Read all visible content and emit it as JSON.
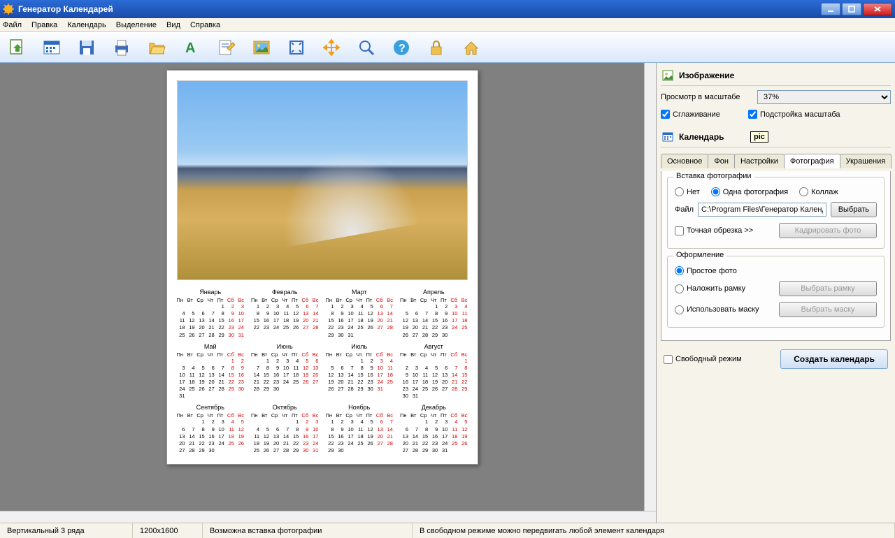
{
  "title": "Генератор Календарей",
  "menu": [
    "Файл",
    "Правка",
    "Календарь",
    "Выделение",
    "Вид",
    "Справка"
  ],
  "toolbar_icons": [
    "new-cal",
    "cal-grid",
    "save",
    "print",
    "folder",
    "font",
    "edit",
    "picture",
    "fit",
    "move",
    "zoom",
    "help",
    "lock",
    "home"
  ],
  "panel": {
    "image_header": "Изображение",
    "scale_label": "Просмотр в масштабе",
    "scale_value": "37%",
    "smooth": "Сглаживание",
    "fitscale": "Подстройка масштаба",
    "calendar_header": "Календарь",
    "tooltip": "pic",
    "tabs": [
      "Основное",
      "Фон",
      "Настройки",
      "Фотография",
      "Украшения"
    ],
    "active_tab": 3,
    "insert_group": "Вставка фотографии",
    "opt_none": "Нет",
    "opt_one": "Одна фотография",
    "opt_collage": "Коллаж",
    "file_label": "Файл",
    "file_value": "C:\\Program Files\\Генератор Календар",
    "file_browse": "Выбрать",
    "crop_cb": "Точная обрезка >>",
    "crop_btn": "Кадрировать фото",
    "style_group": "Оформление",
    "style_simple": "Простое фото",
    "style_frame": "Наложить рамку",
    "style_frame_btn": "Выбрать рамку",
    "style_mask": "Использовать маску",
    "style_mask_btn": "Выбрать маску",
    "free_mode": "Свободный режим",
    "create_btn": "Создать календарь"
  },
  "status": {
    "layout": "Вертикальный 3 ряда",
    "size": "1200x1600",
    "hint1": "Возможна вставка фотографии",
    "hint2": "В свободном режиме можно передвигать любой элемент календаря"
  },
  "calendar": {
    "dow": [
      "Пн",
      "Вт",
      "Ср",
      "Чт",
      "Пт",
      "Сб",
      "Вс"
    ],
    "months": [
      {
        "name": "Январь",
        "start": 4,
        "days": 31
      },
      {
        "name": "Февраль",
        "start": 0,
        "days": 28
      },
      {
        "name": "Март",
        "start": 0,
        "days": 31
      },
      {
        "name": "Апрель",
        "start": 3,
        "days": 30
      },
      {
        "name": "Май",
        "start": 5,
        "days": 31
      },
      {
        "name": "Июнь",
        "start": 1,
        "days": 30
      },
      {
        "name": "Июль",
        "start": 3,
        "days": 31
      },
      {
        "name": "Август",
        "start": 6,
        "days": 31
      },
      {
        "name": "Сентябрь",
        "start": 2,
        "days": 30
      },
      {
        "name": "Октябрь",
        "start": 4,
        "days": 31
      },
      {
        "name": "Ноябрь",
        "start": 0,
        "days": 30
      },
      {
        "name": "Декабрь",
        "start": 2,
        "days": 31
      }
    ]
  }
}
